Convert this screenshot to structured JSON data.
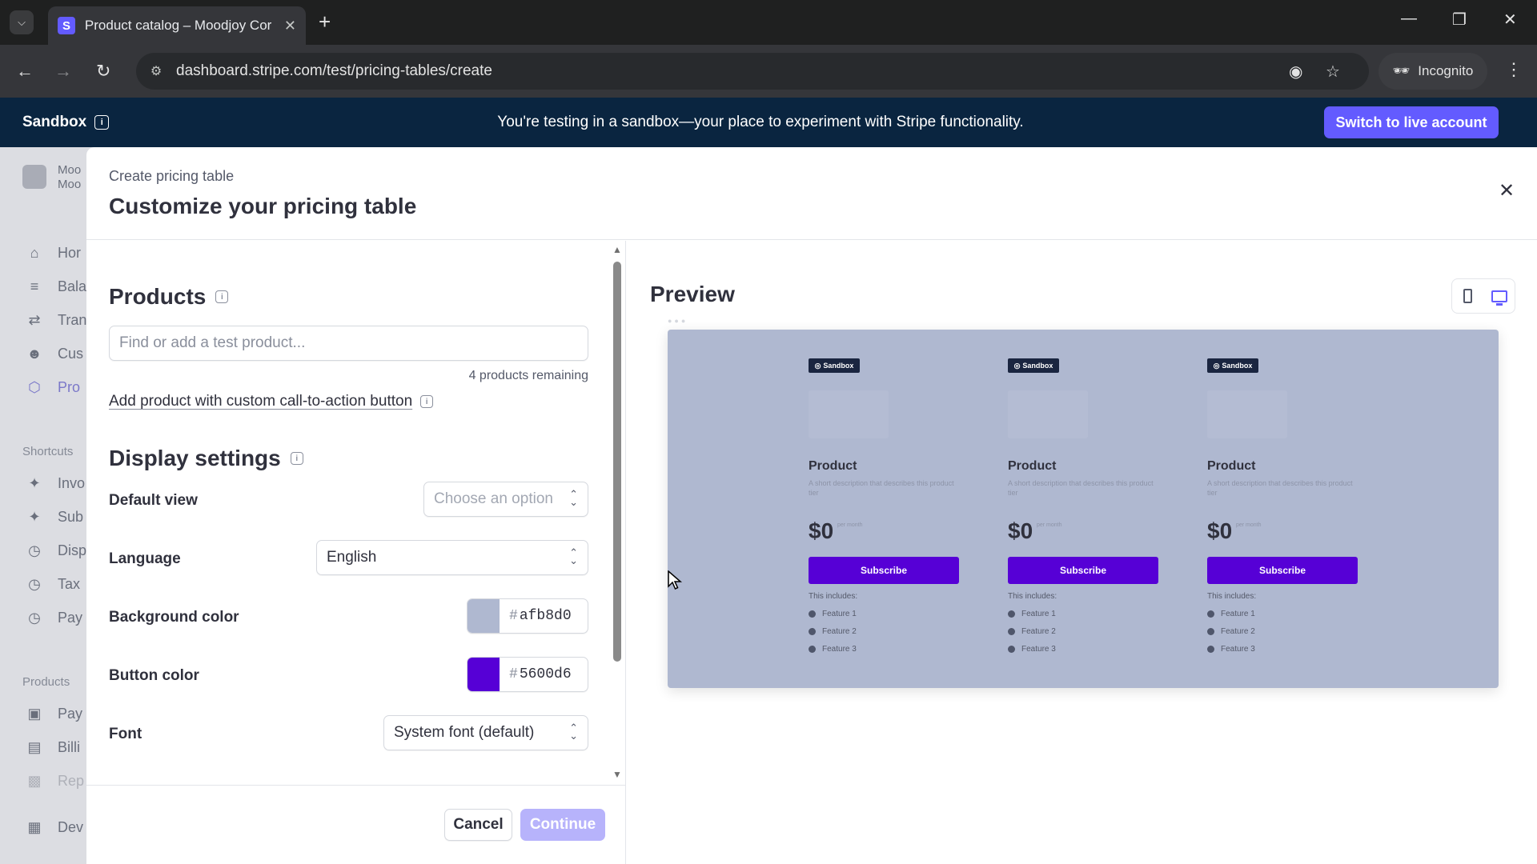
{
  "browser": {
    "tab_title": "Product catalog – Moodjoy Cor",
    "favicon_letter": "S",
    "url": "dashboard.stripe.com/test/pricing-tables/create",
    "profile_label": "Incognito"
  },
  "banner": {
    "mode_label": "Sandbox",
    "message": "You're testing in a sandbox—your place to experiment with Stripe functionality.",
    "switch_button": "Switch to live account",
    "background_color": "#0a2540",
    "button_color": "#635bff"
  },
  "sidebar": {
    "account_line1": "Moo",
    "account_line2": "Moo",
    "items": [
      {
        "label": "Hor",
        "icon": "home-icon"
      },
      {
        "label": "Bala",
        "icon": "balances-icon"
      },
      {
        "label": "Tran",
        "icon": "transactions-icon"
      },
      {
        "label": "Cus",
        "icon": "customers-icon"
      },
      {
        "label": "Pro",
        "icon": "product-icon"
      }
    ],
    "shortcuts_heading": "Shortcuts",
    "shortcuts": [
      {
        "label": "Invo",
        "icon": "pin-icon"
      },
      {
        "label": "Sub",
        "icon": "pin-icon"
      },
      {
        "label": "Disp",
        "icon": "clock-icon"
      },
      {
        "label": "Tax",
        "icon": "clock-icon"
      },
      {
        "label": "Pay",
        "icon": "clock-icon"
      }
    ],
    "products_heading": "Products",
    "product_items": [
      {
        "label": "Pay",
        "icon": "payment-links-icon"
      },
      {
        "label": "Billi",
        "icon": "billing-icon"
      },
      {
        "label": "Rep",
        "icon": "reporting-icon"
      }
    ],
    "developers": {
      "label": "Dev",
      "icon": "terminal-icon"
    }
  },
  "modal": {
    "breadcrumb": "Create pricing table",
    "title": "Customize your pricing table",
    "products": {
      "heading": "Products",
      "search_placeholder": "Find or add a test product...",
      "remaining": "4 products remaining",
      "add_custom_cta": "Add product with custom call-to-action button"
    },
    "display_settings": {
      "heading": "Display settings",
      "default_view_label": "Default view",
      "default_view_placeholder": "Choose an option",
      "language_label": "Language",
      "language_value": "English",
      "background_color_label": "Background color",
      "background_color_value": "afb8d0",
      "background_color_hex": "#afb8d0",
      "button_color_label": "Button color",
      "button_color_value": "5600d6",
      "button_color_hex": "#5600d6",
      "font_label": "Font",
      "font_value": "System font (default)"
    },
    "cancel": "Cancel",
    "continue": "Continue",
    "preview": {
      "heading": "Preview",
      "device_options": [
        "mobile-icon",
        "desktop-icon"
      ],
      "selected_device": "desktop-icon",
      "cards": [
        {
          "badge": "Sandbox",
          "name": "Product",
          "description": "A short description that describes this product tier",
          "price": "$0",
          "period": "per month",
          "button": "Subscribe",
          "includes": "This includes:",
          "features": [
            "Feature 1",
            "Feature 2",
            "Feature 3"
          ]
        },
        {
          "badge": "Sandbox",
          "name": "Product",
          "description": "A short description that describes this product tier",
          "price": "$0",
          "period": "per month",
          "button": "Subscribe",
          "includes": "This includes:",
          "features": [
            "Feature 1",
            "Feature 2",
            "Feature 3"
          ]
        },
        {
          "badge": "Sandbox",
          "name": "Product",
          "description": "A short description that describes this product tier",
          "price": "$0",
          "period": "per month",
          "button": "Subscribe",
          "includes": "This includes:",
          "features": [
            "Feature 1",
            "Feature 2",
            "Feature 3"
          ]
        }
      ]
    }
  }
}
